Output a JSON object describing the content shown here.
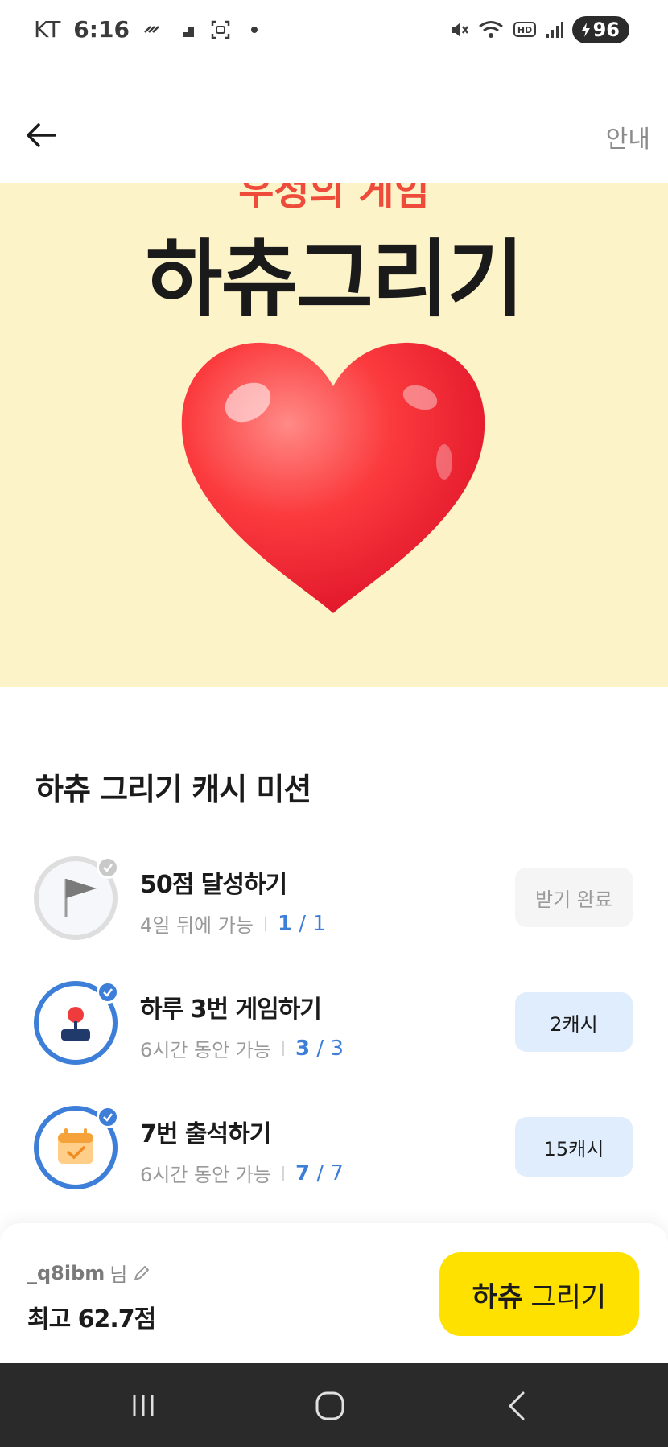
{
  "status_bar": {
    "carrier": "KT",
    "time": "6:16",
    "battery": "96"
  },
  "header": {
    "info_label": "안내"
  },
  "banner": {
    "subtitle": "우정의 게임",
    "title": "하츄그리기"
  },
  "missions_section": {
    "title": "하츄 그리기 캐시 미션",
    "missions": [
      {
        "title": "50점 달성하기",
        "meta": "4일 뒤에 가능",
        "progress_current": "1",
        "progress_total": "1",
        "button_label": "받기 완료",
        "icon": "flag-icon"
      },
      {
        "title": "하루 3번 게임하기",
        "meta": "6시간 동안 가능",
        "progress_current": "3",
        "progress_total": "3",
        "button_label": "2캐시",
        "icon": "joystick-icon"
      },
      {
        "title": "7번 출석하기",
        "meta": "6시간 동안 가능",
        "progress_current": "7",
        "progress_total": "7",
        "button_label": "15캐시",
        "icon": "calendar-check-icon"
      }
    ]
  },
  "bottom_bar": {
    "username": "_q8ibm",
    "username_suffix": "님",
    "best_score": "최고 62.7점",
    "draw_button_bold": "하츄",
    "draw_button_rest": "그리기"
  },
  "colors": {
    "accent_blue": "#3c7ed8",
    "banner_bg": "#fdf3c9",
    "cta_yellow": "#ffe100"
  }
}
